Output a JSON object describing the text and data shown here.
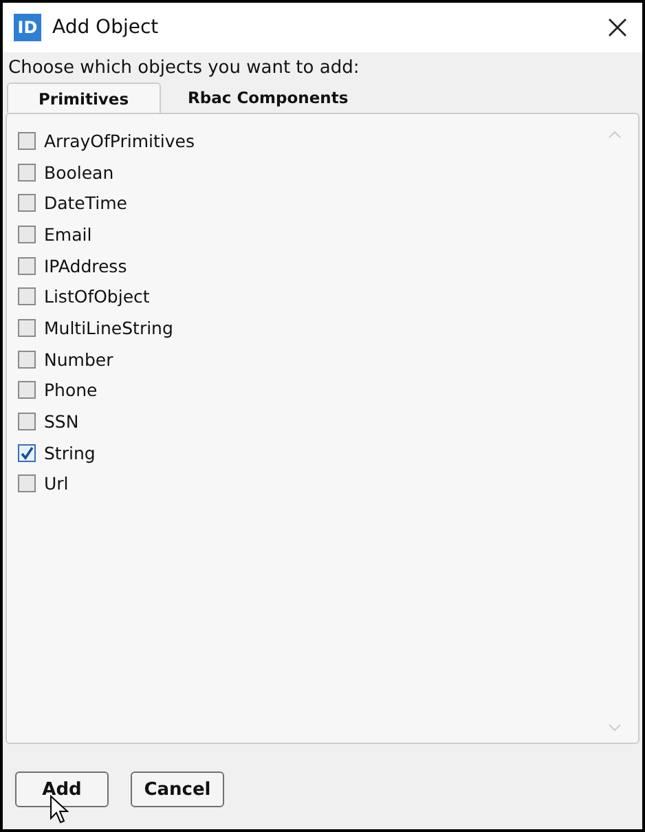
{
  "window": {
    "title": "Add Object",
    "app_icon": "ID"
  },
  "instruction": "Choose which objects you want to add:",
  "tabs": [
    {
      "label": "Primitives",
      "selected": true
    },
    {
      "label": "Rbac Components",
      "selected": false
    }
  ],
  "items": [
    {
      "label": "ArrayOfPrimitives",
      "checked": false
    },
    {
      "label": "Boolean",
      "checked": false
    },
    {
      "label": "DateTime",
      "checked": false
    },
    {
      "label": "Email",
      "checked": false
    },
    {
      "label": "IPAddress",
      "checked": false
    },
    {
      "label": "ListOfObject",
      "checked": false
    },
    {
      "label": "MultiLineString",
      "checked": false
    },
    {
      "label": "Number",
      "checked": false
    },
    {
      "label": "Phone",
      "checked": false
    },
    {
      "label": "SSN",
      "checked": false
    },
    {
      "label": "String",
      "checked": true
    },
    {
      "label": "Url",
      "checked": false
    }
  ],
  "buttons": [
    "Add",
    "Cancel"
  ]
}
